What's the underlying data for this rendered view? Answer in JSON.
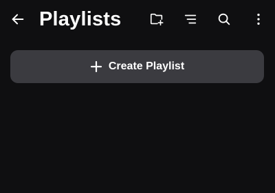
{
  "header": {
    "title": "Playlists",
    "back_icon": "arrow-left-icon",
    "actions": [
      {
        "name": "new-folder",
        "icon": "folder-plus-icon"
      },
      {
        "name": "sort",
        "icon": "sort-lines-icon"
      },
      {
        "name": "search",
        "icon": "search-icon"
      },
      {
        "name": "more",
        "icon": "more-vertical-icon"
      }
    ]
  },
  "main": {
    "create_label": "Create Playlist",
    "create_icon": "plus-icon"
  },
  "colors": {
    "background": "#0f0f11",
    "button": "#3b3b40",
    "text": "#ffffff"
  }
}
